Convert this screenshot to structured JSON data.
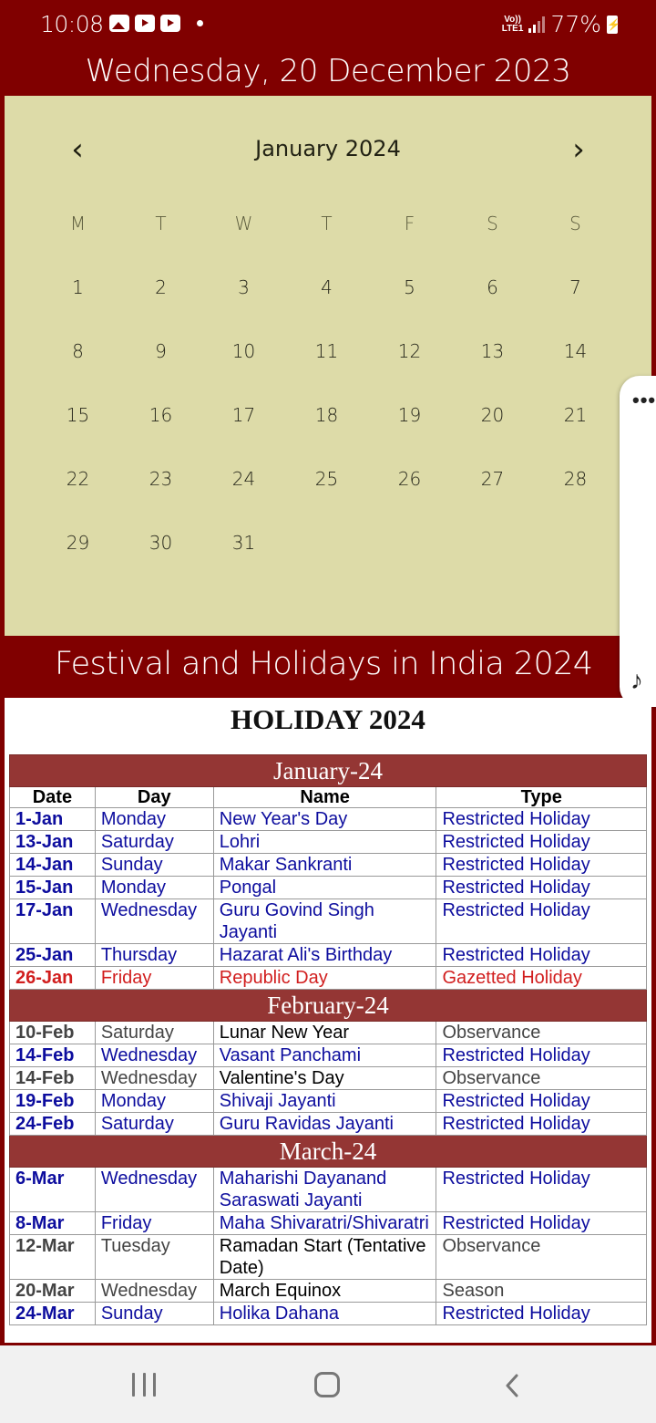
{
  "status_bar": {
    "time": "10:08",
    "notification_icons": [
      "gallery-icon",
      "youtube-icon",
      "youtube-icon",
      "more-dot"
    ],
    "network_label_top": "Vo))",
    "network_label_bottom": "LTE1",
    "battery_percent": "77%"
  },
  "header": {
    "current_date": "Wednesday, 20 December 2023"
  },
  "calendar": {
    "month_label": "January 2024",
    "prev_icon": "‹",
    "next_icon": "›",
    "weekdays": [
      "M",
      "T",
      "W",
      "T",
      "F",
      "S",
      "S"
    ],
    "leading_blank_days": 0,
    "days_in_month": 31
  },
  "side_widget": {
    "more_icon": "•••",
    "music_icon": "♪"
  },
  "festival_section": {
    "title": "Festival and Holidays in India 2024",
    "image_heading": "HOLIDAY 2024",
    "columns": [
      "Date",
      "Day",
      "Name",
      "Type"
    ],
    "months": [
      {
        "label": "January-24",
        "rows": [
          {
            "date": "1-Jan",
            "day": "Monday",
            "name": "New Year's Day",
            "type": "Restricted Holiday",
            "category": "restricted"
          },
          {
            "date": "13-Jan",
            "day": "Saturday",
            "name": "Lohri",
            "type": "Restricted Holiday",
            "category": "restricted"
          },
          {
            "date": "14-Jan",
            "day": "Sunday",
            "name": "Makar Sankranti",
            "type": "Restricted Holiday",
            "category": "restricted"
          },
          {
            "date": "15-Jan",
            "day": "Monday",
            "name": "Pongal",
            "type": "Restricted Holiday",
            "category": "restricted"
          },
          {
            "date": "17-Jan",
            "day": "Wednesday",
            "name": "Guru Govind Singh Jayanti",
            "type": "Restricted Holiday",
            "category": "restricted"
          },
          {
            "date": "25-Jan",
            "day": "Thursday",
            "name": "Hazarat Ali's Birthday",
            "type": "Restricted Holiday",
            "category": "restricted"
          },
          {
            "date": "26-Jan",
            "day": "Friday",
            "name": "Republic Day",
            "type": "Gazetted Holiday",
            "category": "gazetted"
          }
        ]
      },
      {
        "label": "February-24",
        "rows": [
          {
            "date": "10-Feb",
            "day": "Saturday",
            "name": "Lunar New Year",
            "type": "Observance",
            "category": "observance"
          },
          {
            "date": "14-Feb",
            "day": "Wednesday",
            "name": "Vasant Panchami",
            "type": "Restricted Holiday",
            "category": "restricted"
          },
          {
            "date": "14-Feb",
            "day": "Wednesday",
            "name": "Valentine's Day",
            "type": "Observance",
            "category": "observance"
          },
          {
            "date": "19-Feb",
            "day": "Monday",
            "name": "Shivaji Jayanti",
            "type": "Restricted Holiday",
            "category": "restricted"
          },
          {
            "date": "24-Feb",
            "day": "Saturday",
            "name": "Guru Ravidas Jayanti",
            "type": "Restricted Holiday",
            "category": "restricted"
          }
        ]
      },
      {
        "label": "March-24",
        "rows": [
          {
            "date": "6-Mar",
            "day": "Wednesday",
            "name": "Maharishi Dayanand Saraswati Jayanti",
            "type": "Restricted Holiday",
            "category": "restricted"
          },
          {
            "date": "8-Mar",
            "day": "Friday",
            "name": "Maha Shivaratri/Shivaratri",
            "type": "Restricted Holiday",
            "category": "restricted"
          },
          {
            "date": "12-Mar",
            "day": "Tuesday",
            "name": "Ramadan Start (Tentative Date)",
            "type": "Observance",
            "category": "observance"
          },
          {
            "date": "20-Mar",
            "day": "Wednesday",
            "name": "March Equinox",
            "type": "Season",
            "category": "season"
          },
          {
            "date": "24-Mar",
            "day": "Sunday",
            "name": "Holika Dahana",
            "type": "Restricted Holiday",
            "category": "restricted"
          }
        ]
      }
    ]
  },
  "colors": {
    "app_bar": "#800000",
    "calendar_bg": "#dddba8",
    "month_header": "#943634",
    "restricted_text": "#0d0d9e",
    "gazetted_text": "#d11e1e",
    "observance_text": "#444444",
    "nav_bar": "#f1f1f1"
  },
  "nav_bar": {
    "recent_label": "Recent apps",
    "home_label": "Home",
    "back_label": "Back"
  }
}
